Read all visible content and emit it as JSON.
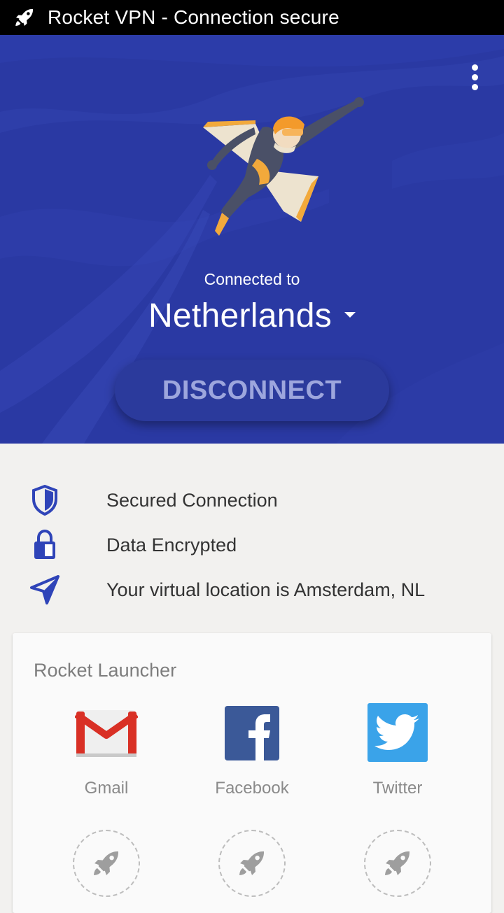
{
  "notification": {
    "title": "Rocket VPN - Connection secure",
    "icon": "rocket-icon"
  },
  "hero": {
    "background": "#2a39a3",
    "menu_icon": "more-vert-icon",
    "connected_label": "Connected to",
    "country": "Netherlands",
    "button_label": "DISCONNECT"
  },
  "status": [
    {
      "icon": "shield-icon",
      "text": "Secured Connection"
    },
    {
      "icon": "lock-icon",
      "text": "Data Encrypted"
    },
    {
      "icon": "navigation-arrow-icon",
      "text": "Your virtual location is Amsterdam, NL"
    }
  ],
  "launcher": {
    "title": "Rocket Launcher",
    "apps": [
      {
        "name": "Gmail",
        "icon": "gmail-icon"
      },
      {
        "name": "Facebook",
        "icon": "facebook-icon"
      },
      {
        "name": "Twitter",
        "icon": "twitter-icon"
      }
    ],
    "empty_slot_icon": "rocket-icon"
  },
  "colors": {
    "accent": "#2a39a3",
    "icon_blue": "#2f44b8",
    "facebook": "#3b5998",
    "twitter": "#1da1f2",
    "gmail_red": "#d93025"
  }
}
